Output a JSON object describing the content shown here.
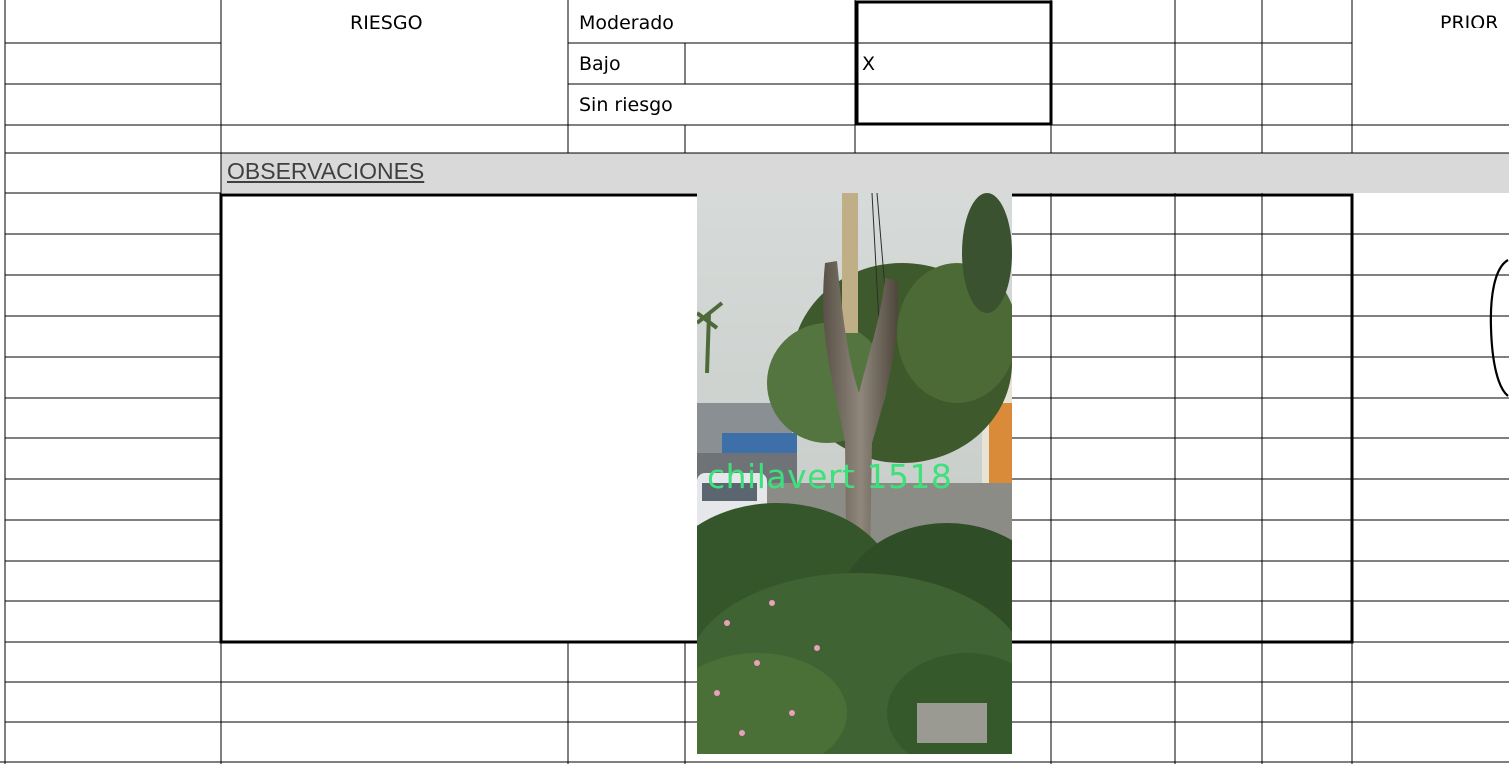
{
  "sheet": {
    "riesgo_label": "RIESGO",
    "risk_levels": [
      {
        "label": "Moderado",
        "mark": ""
      },
      {
        "label": "Bajo",
        "mark": "X"
      },
      {
        "label": "Sin riesgo",
        "mark": ""
      }
    ],
    "prioridad_label": "PRIOR",
    "observaciones_label": "OBSERVACIONES"
  },
  "photo": {
    "caption": "chilavert 1518"
  },
  "colors": {
    "header_band": "#d9d9d9",
    "caption_text": "#3ee07a",
    "grid_line": "#000000"
  }
}
